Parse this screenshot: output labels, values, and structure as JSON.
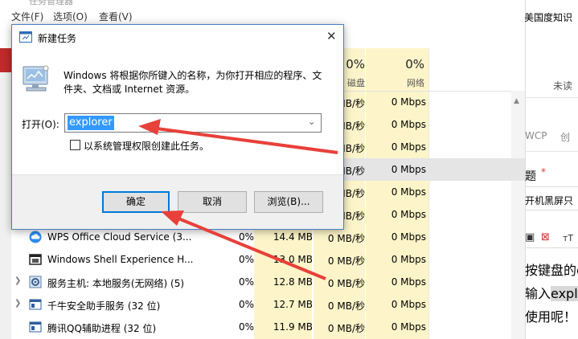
{
  "task_manager": {
    "title": "任务管理器",
    "menu": [
      "文件(F)",
      "选项(O)",
      "查看(V)"
    ],
    "headers": {
      "disk_pct": "0%",
      "disk_label": "磁盘",
      "net_pct": "0%",
      "net_label": "网络"
    },
    "partial_rows": [
      {
        "disk": "0 MB/秒",
        "net": "0 Mbps"
      },
      {
        "disk": "0 MB/秒",
        "net": "0 Mbps"
      },
      {
        "disk": "0 MB/秒",
        "net": "0 Mbps"
      },
      {
        "disk": "0 MB/秒",
        "net": "0 Mbps"
      },
      {
        "disk": "0 MB/秒",
        "net": "0 Mbps"
      },
      {
        "disk": "0 MB/秒",
        "net": "0 Mbps"
      }
    ],
    "rows": [
      {
        "name": "WPS Office Cloud Service (3...",
        "cpu": "0%",
        "mem": "14.4 MB",
        "disk": "0 MB/秒",
        "net": "0 Mbps",
        "expandable": false,
        "icon": "cloud-icon"
      },
      {
        "name": "Windows Shell Experience H...",
        "cpu": "0%",
        "mem": "13.0 MB",
        "disk": "0 MB/秒",
        "net": "0 Mbps",
        "expandable": false,
        "icon": "window-icon"
      },
      {
        "name": "服务主机: 本地服务(无网络) (5)",
        "cpu": "0%",
        "mem": "12.8 MB",
        "disk": "0 MB/秒",
        "net": "0 Mbps",
        "expandable": true,
        "icon": "gear-icon"
      },
      {
        "name": "千牛安全助手服务 (32 位)",
        "cpu": "0%",
        "mem": "12.7 MB",
        "disk": "0 MB/秒",
        "net": "0 Mbps",
        "expandable": true,
        "icon": "app-icon"
      },
      {
        "name": "腾讯QQ辅助进程 (32 位)",
        "cpu": "0%",
        "mem": "11.9 MB",
        "disk": "0 MB/秒",
        "net": "0 Mbps",
        "expandable": false,
        "icon": "app-icon"
      }
    ]
  },
  "web": {
    "top_text": "美国度知识",
    "unread": "未读",
    "wcp": "WCP",
    "chuang": "创",
    "ti": "题",
    "star": "*",
    "line1": "开机黑屏只",
    "line2": "按键盘的c",
    "line3_pre": "输入",
    "line3_hl": "explo",
    "line4": "使用呢！"
  },
  "dialog": {
    "title": "新建任务",
    "description": "Windows 将根据你所键入的名称，为你打开相应的程序、文件夹、文档或 Internet 资源。",
    "open_label": "打开(O):",
    "input_value": "explorer",
    "admin_checkbox_label": "以系统管理权限创建此任务。",
    "ok_label": "确定",
    "cancel_label": "取消",
    "browse_label": "浏览(B)..."
  },
  "colors": {
    "accent": "#0078d7",
    "highlight_column": "#fdf5c9",
    "arrow_red": "#e8403a",
    "selection": "#3399ff"
  }
}
